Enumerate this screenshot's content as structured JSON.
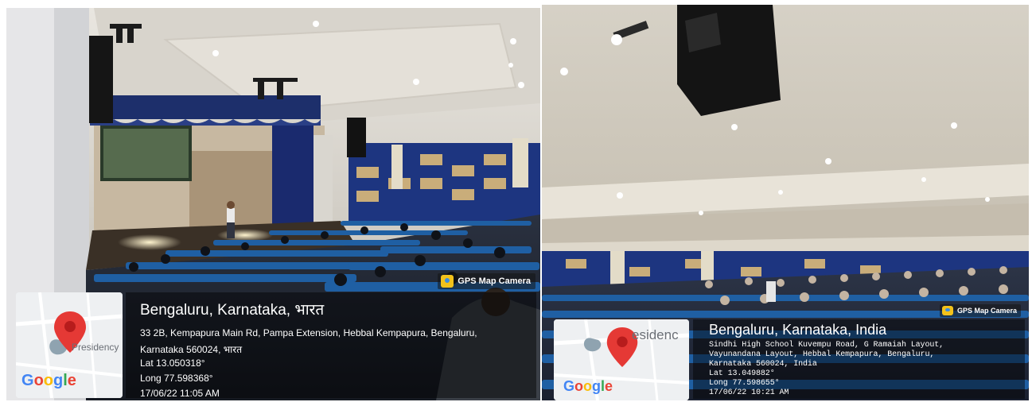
{
  "photos": [
    {
      "gps_badge": "GPS Map Camera",
      "map": {
        "label": "Presidency",
        "logo": "Google"
      },
      "location": {
        "title": "Bengaluru, Karnataka, भारत",
        "address_line1": "33 2B, Kempapura Main Rd, Pampa Extension, Hebbal Kempapura, Bengaluru,",
        "address_line2": "Karnataka 560024, भारत",
        "lat": "Lat 13.050318°",
        "long": "Long 77.598368°",
        "datetime": "17/06/22 11:05 AM"
      }
    },
    {
      "gps_badge": "GPS Map Camera",
      "map": {
        "label": "esidenc",
        "logo": "Google"
      },
      "location": {
        "title": "Bengaluru, Karnataka, India",
        "address_line1": "Sindhi High School Kuvempu Road, G Ramaiah Layout,",
        "address_line2": "Vayunandana Layout, Hebbal Kempapura, Bengaluru,",
        "address_line3": "Karnataka 560024, India",
        "lat": "Lat 13.049882°",
        "long": "Long 77.598655°",
        "datetime": "17/06/22 10:21 AM"
      }
    }
  ],
  "icons": {
    "gps_app": "gps-map-camera-icon",
    "map_pin": "map-pin-icon"
  },
  "colors": {
    "pin_red": "#e53935",
    "panel_overlay": "rgba(0,0,0,0.45)",
    "seat_blue": "#1f5fa3"
  }
}
